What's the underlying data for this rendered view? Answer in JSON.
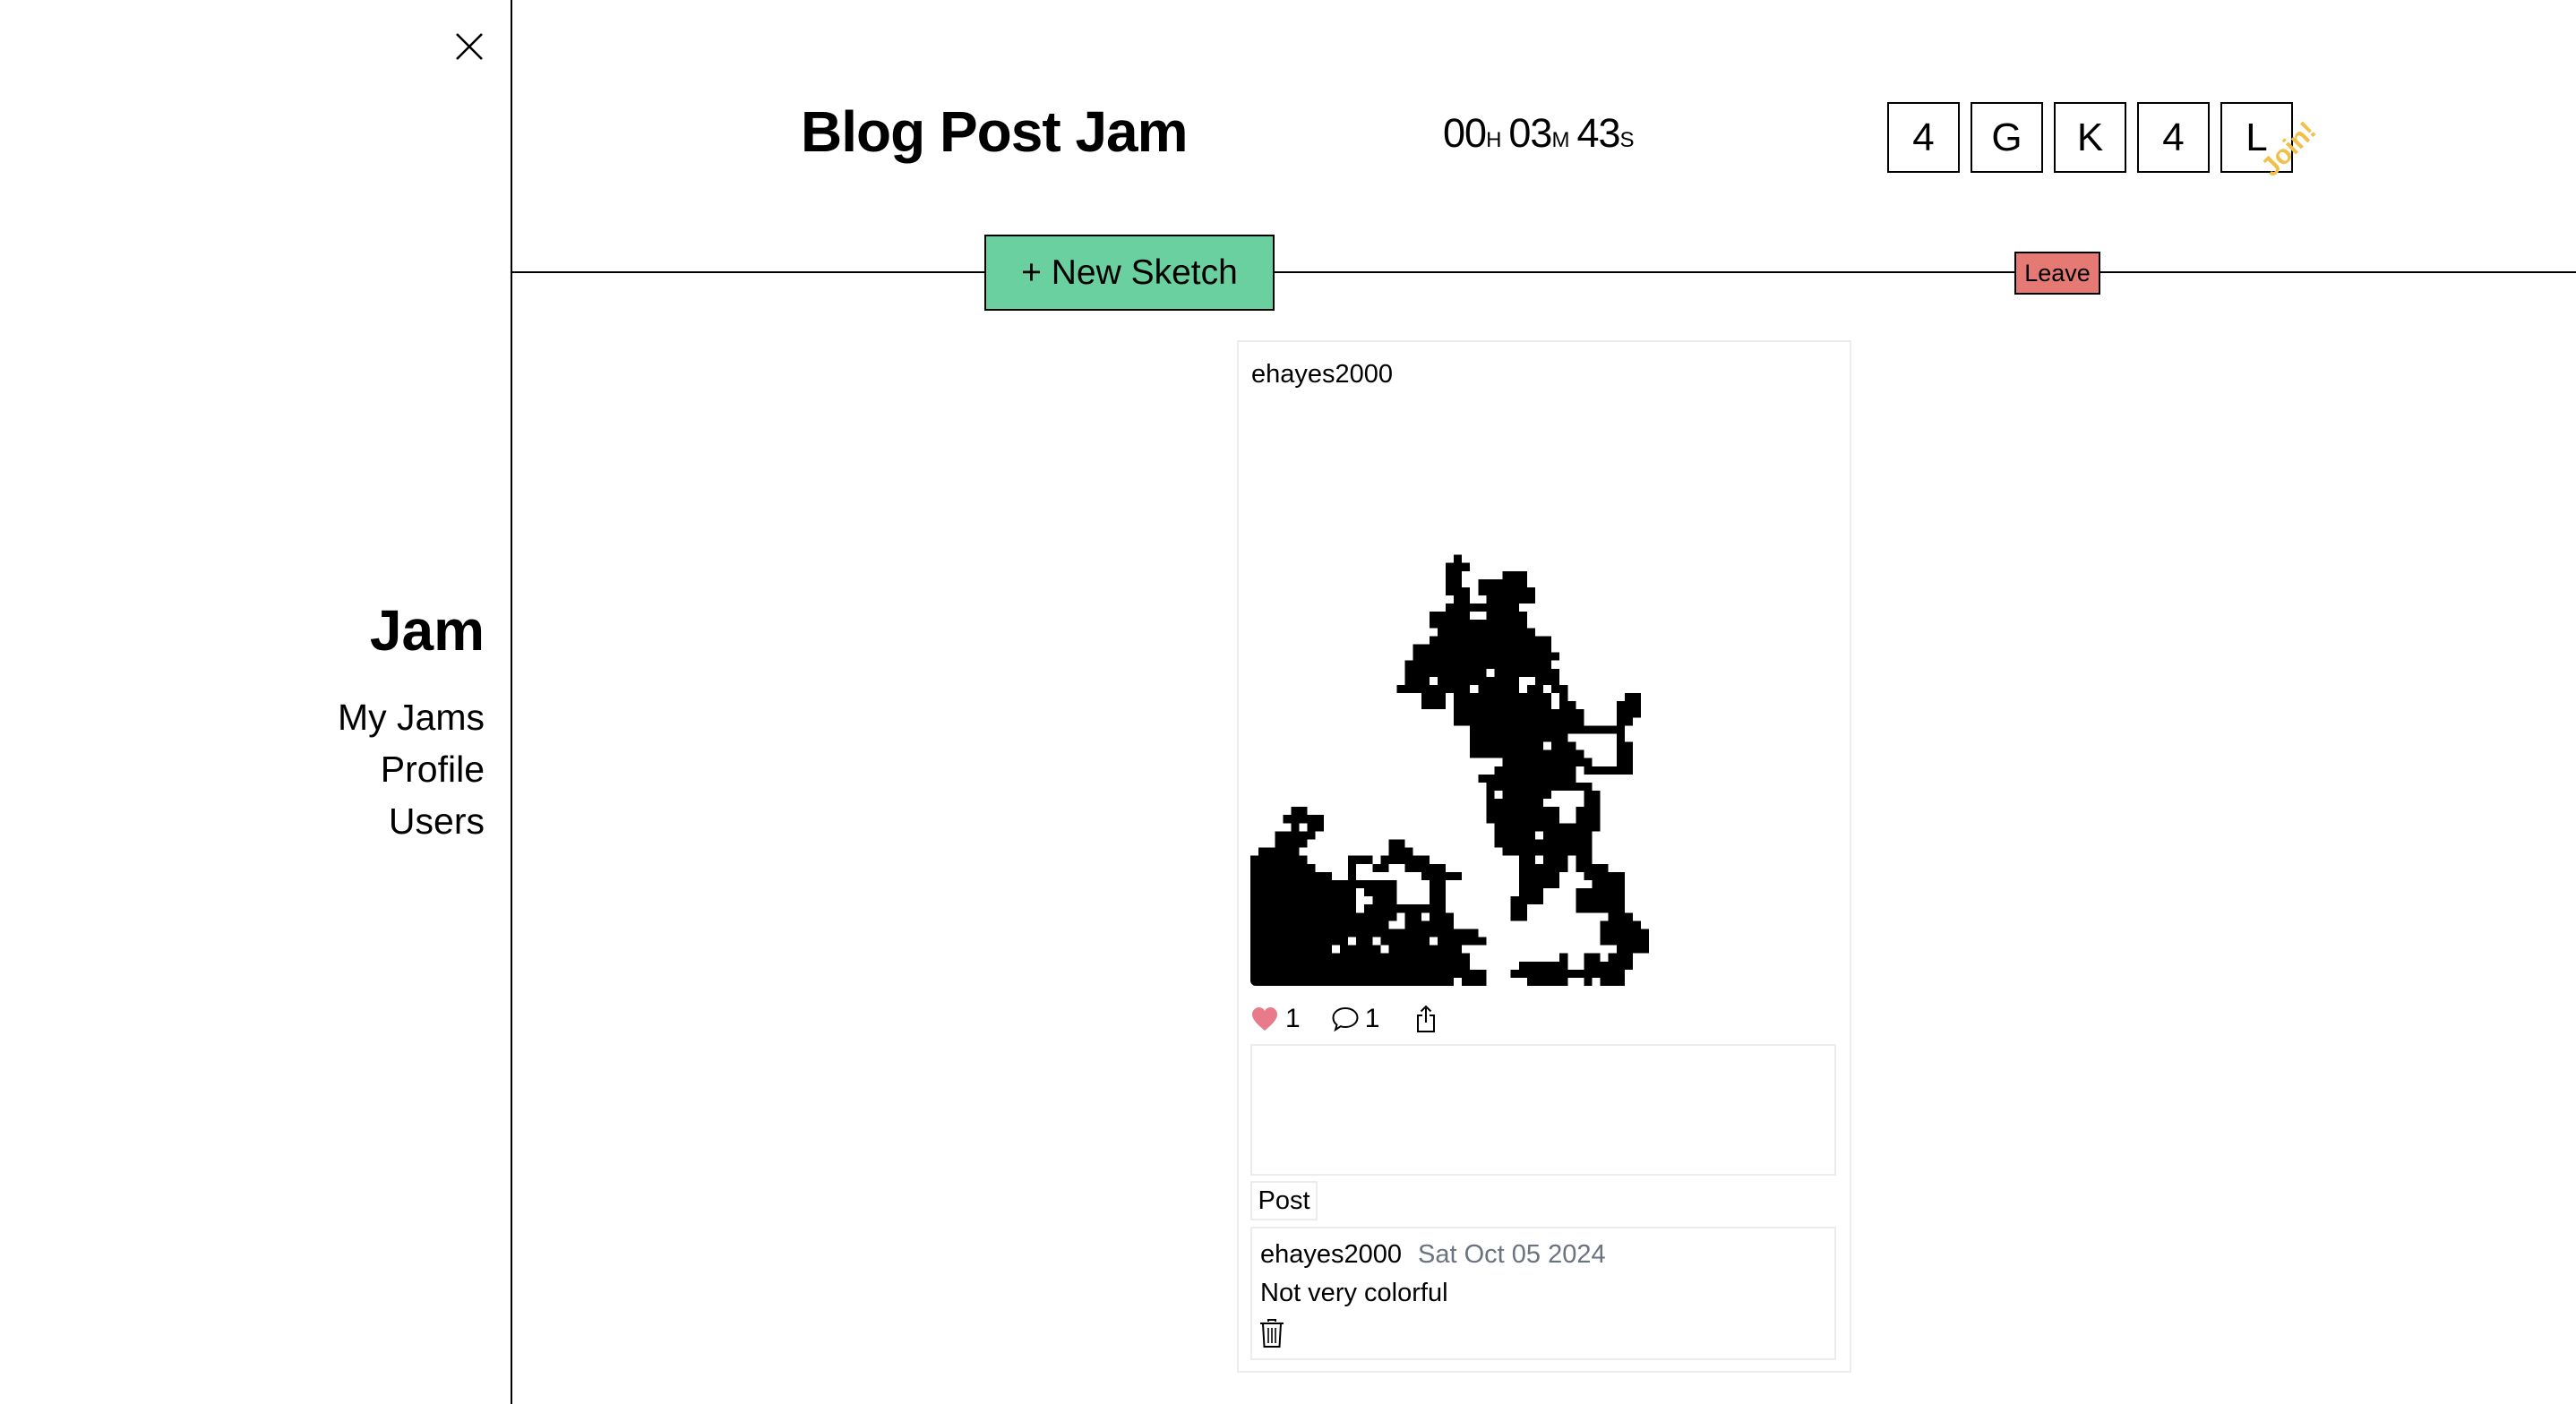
{
  "sidebar": {
    "close_icon": "close-icon",
    "title": "Jam",
    "nav": [
      {
        "label": "My Jams"
      },
      {
        "label": "Profile"
      },
      {
        "label": "Users"
      }
    ]
  },
  "header": {
    "title": "Blog Post Jam",
    "timer": {
      "hours": "00",
      "hours_unit": "H",
      "minutes": "03",
      "minutes_unit": "M",
      "seconds": "43",
      "seconds_unit": "S"
    },
    "join_code": [
      "4",
      "G",
      "K",
      "4",
      "L"
    ],
    "join_label": "Join!",
    "new_sketch_label": "+ New Sketch",
    "leave_label": "Leave"
  },
  "colors": {
    "new_sketch_bg": "#6BD09F",
    "leave_bg": "#E57A74",
    "join_label": "#F0C04A",
    "like_heart": "#E87A8A",
    "date_text": "#6B7280"
  },
  "post": {
    "author": "ehayes2000",
    "likes": "1",
    "comments_count": "1",
    "like_icon": "heart-icon",
    "comment_icon": "speech-bubble-icon",
    "share_icon": "share-icon",
    "comment_placeholder": "",
    "comment_value": "",
    "post_label": "Post",
    "sketch": {
      "grid_size": 72,
      "fill": "#000000",
      "rows": {
        "19": [
          [
            25,
            25
          ]
        ],
        "20": [
          [
            24,
            26
          ]
        ],
        "21": [
          [
            24,
            25
          ],
          [
            31,
            33
          ]
        ],
        "22": [
          [
            24,
            25
          ],
          [
            28,
            33
          ]
        ],
        "23": [
          [
            24,
            26
          ],
          [
            28,
            34
          ]
        ],
        "24": [
          [
            25,
            26
          ],
          [
            29,
            34
          ]
        ],
        "25": [
          [
            24,
            32
          ]
        ],
        "26": [
          [
            22,
            26
          ],
          [
            29,
            33
          ]
        ],
        "27": [
          [
            22,
            33
          ]
        ],
        "28": [
          [
            23,
            34
          ]
        ],
        "29": [
          [
            22,
            36
          ]
        ],
        "30": [
          [
            20,
            36
          ]
        ],
        "31": [
          [
            20,
            37
          ]
        ],
        "32": [
          [
            19,
            36
          ]
        ],
        "33": [
          [
            19,
            28
          ],
          [
            30,
            37
          ]
        ],
        "34": [
          [
            19,
            21
          ],
          [
            23,
            32
          ],
          [
            35,
            37
          ]
        ],
        "35": [
          [
            18,
            26
          ],
          [
            28,
            32
          ],
          [
            34,
            35
          ],
          [
            37,
            38
          ]
        ],
        "36": [
          [
            21,
            23
          ],
          [
            25,
            36
          ],
          [
            38,
            38
          ],
          [
            46,
            47
          ]
        ],
        "37": [
          [
            21,
            23
          ],
          [
            25,
            36
          ],
          [
            38,
            39
          ],
          [
            45,
            47
          ]
        ],
        "38": [
          [
            25,
            40
          ],
          [
            45,
            47
          ]
        ],
        "39": [
          [
            25,
            40
          ],
          [
            45,
            46
          ]
        ],
        "40": [
          [
            27,
            45
          ]
        ],
        "41": [
          [
            27,
            38
          ],
          [
            45,
            45
          ]
        ],
        "42": [
          [
            27,
            35
          ],
          [
            37,
            39
          ],
          [
            45,
            46
          ]
        ],
        "43": [
          [
            27,
            40
          ],
          [
            45,
            46
          ]
        ],
        "44": [
          [
            31,
            41
          ],
          [
            45,
            46
          ]
        ],
        "45": [
          [
            30,
            39
          ],
          [
            41,
            46
          ]
        ],
        "46": [
          [
            28,
            39
          ]
        ],
        "47": [
          [
            29,
            41
          ]
        ],
        "48": [
          [
            29,
            29
          ],
          [
            31,
            36
          ],
          [
            41,
            42
          ]
        ],
        "49": [
          [
            29,
            35
          ],
          [
            41,
            42
          ]
        ],
        "50": [
          [
            5,
            6
          ],
          [
            29,
            37
          ],
          [
            40,
            42
          ]
        ],
        "51": [
          [
            4,
            8
          ],
          [
            29,
            37
          ],
          [
            40,
            42
          ]
        ],
        "52": [
          [
            5,
            5
          ],
          [
            7,
            8
          ],
          [
            30,
            42
          ]
        ],
        "53": [
          [
            3,
            7
          ],
          [
            30,
            34
          ],
          [
            36,
            41
          ]
        ],
        "54": [
          [
            3,
            6
          ],
          [
            17,
            18
          ],
          [
            30,
            41
          ]
        ],
        "55": [
          [
            1,
            5
          ],
          [
            17,
            19
          ],
          [
            31,
            41
          ]
        ],
        "56": [
          [
            0,
            6
          ],
          [
            12,
            14
          ],
          [
            16,
            21
          ],
          [
            33,
            34
          ],
          [
            36,
            38
          ],
          [
            40,
            41
          ]
        ],
        "57": [
          [
            0,
            7
          ],
          [
            12,
            12
          ],
          [
            15,
            16
          ],
          [
            19,
            23
          ],
          [
            33,
            38
          ],
          [
            40,
            43
          ]
        ],
        "58": [
          [
            0,
            9
          ],
          [
            12,
            12
          ],
          [
            21,
            25
          ],
          [
            33,
            37
          ],
          [
            41,
            45
          ]
        ],
        "59": [
          [
            0,
            17
          ],
          [
            22,
            23
          ],
          [
            33,
            37
          ],
          [
            42,
            45
          ]
        ],
        "60": [
          [
            0,
            12
          ],
          [
            14,
            17
          ],
          [
            22,
            23
          ],
          [
            33,
            35
          ],
          [
            40,
            45
          ]
        ],
        "61": [
          [
            0,
            12
          ],
          [
            15,
            17
          ],
          [
            22,
            23
          ],
          [
            32,
            35
          ],
          [
            40,
            45
          ]
        ],
        "62": [
          [
            0,
            12
          ],
          [
            14,
            23
          ],
          [
            32,
            33
          ],
          [
            40,
            45
          ]
        ],
        "63": [
          [
            0,
            17
          ],
          [
            19,
            20
          ],
          [
            22,
            24
          ],
          [
            32,
            33
          ],
          [
            44,
            46
          ]
        ],
        "64": [
          [
            0,
            16
          ],
          [
            19,
            24
          ],
          [
            43,
            47
          ]
        ],
        "65": [
          [
            0,
            27
          ],
          [
            43,
            48
          ]
        ],
        "66": [
          [
            0,
            11
          ],
          [
            13,
            14
          ],
          [
            16,
            21
          ],
          [
            23,
            28
          ],
          [
            43,
            48
          ]
        ],
        "67": [
          [
            0,
            9
          ],
          [
            11,
            15
          ],
          [
            17,
            25
          ],
          [
            45,
            48
          ]
        ],
        "68": [
          [
            0,
            26
          ],
          [
            38,
            38
          ],
          [
            41,
            42
          ],
          [
            44,
            46
          ]
        ],
        "69": [
          [
            0,
            26
          ],
          [
            33,
            38
          ],
          [
            41,
            46
          ]
        ],
        "70": [
          [
            0,
            28
          ],
          [
            32,
            45
          ]
        ],
        "71": [
          [
            0,
            24
          ],
          [
            26,
            28
          ],
          [
            34,
            38
          ],
          [
            41,
            41
          ],
          [
            43,
            45
          ]
        ]
      }
    },
    "comment_list": [
      {
        "author": "ehayes2000",
        "date": "Sat Oct 05 2024",
        "text": "Not very colorful",
        "delete_icon": "trash-icon"
      }
    ]
  }
}
